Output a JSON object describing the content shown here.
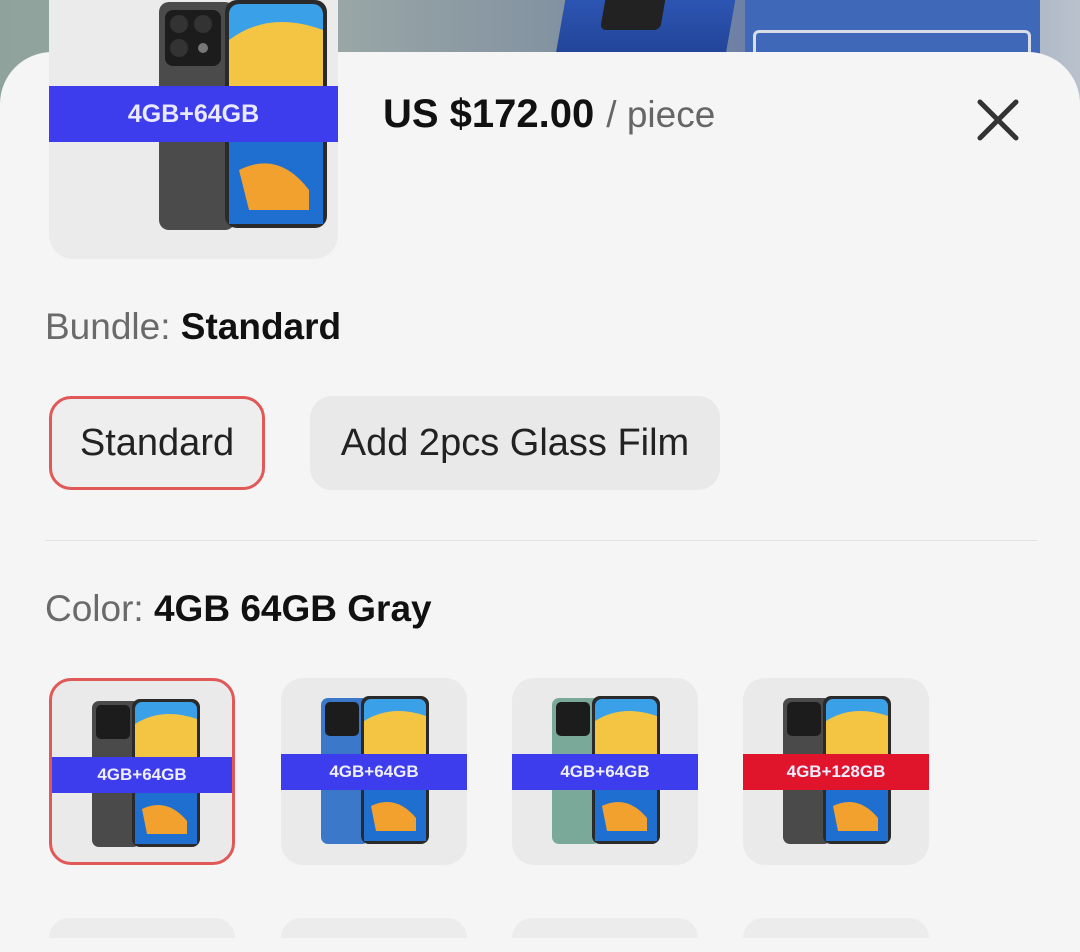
{
  "product": {
    "main_badge": "4GB+64GB",
    "price": "US $172.00",
    "unit": "/ piece"
  },
  "bundle": {
    "label": "Bundle:",
    "selected": "Standard",
    "options": [
      "Standard",
      "Add 2pcs Glass Film"
    ]
  },
  "color": {
    "label": "Color:",
    "selected": "4GB 64GB Gray",
    "swatches": [
      {
        "badge": "4GB+64GB",
        "badge_color": "#3d3ded",
        "body_color": "#4a4a4a"
      },
      {
        "badge": "4GB+64GB",
        "badge_color": "#3d3ded",
        "body_color": "#3b78c9"
      },
      {
        "badge": "4GB+64GB",
        "badge_color": "#3d3ded",
        "body_color": "#7aa99a"
      },
      {
        "badge": "4GB+128GB",
        "badge_color": "#e0152b",
        "body_color": "#4a4a4a"
      }
    ]
  },
  "icons": {
    "close": "close-icon"
  },
  "colors": {
    "accent_border": "#e15858",
    "badge_blue": "#3d3ded",
    "badge_red": "#e0152b"
  }
}
